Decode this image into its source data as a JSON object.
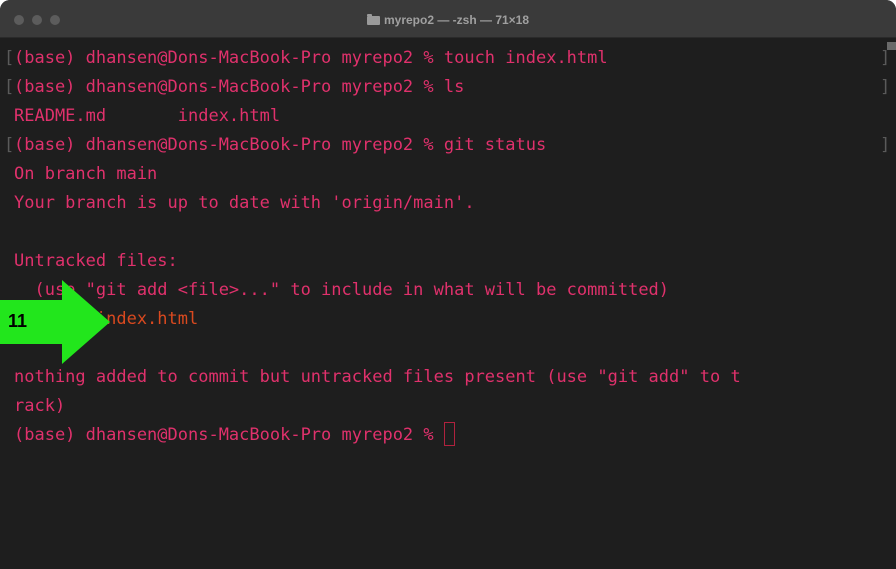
{
  "window": {
    "title": "myrepo2 — -zsh — 71×18",
    "folder_icon": "folder-icon"
  },
  "terminal": {
    "lines": [
      "(base) dhansen@Dons-MacBook-Pro myrepo2 % touch index.html",
      "(base) dhansen@Dons-MacBook-Pro myrepo2 % ls",
      "README.md       index.html",
      "(base) dhansen@Dons-MacBook-Pro myrepo2 % git status",
      "On branch main",
      "Your branch is up to date with 'origin/main'.",
      "",
      "Untracked files:",
      "  (use \"git add <file>...\" to include in what will be committed)",
      "        index.html",
      "",
      "nothing added to commit but untracked files present (use \"git add\" to t",
      "rack)",
      "(base) dhansen@Dons-MacBook-Pro myrepo2 % "
    ]
  },
  "annotation": {
    "step_number": "11",
    "arrow_color": "#22e61c"
  },
  "colors": {
    "terminal_bg": "#1e1e1e",
    "prompt_text": "#e0316c",
    "untracked_file": "#d9491f",
    "titlebar_bg": "#3a3a3a"
  }
}
